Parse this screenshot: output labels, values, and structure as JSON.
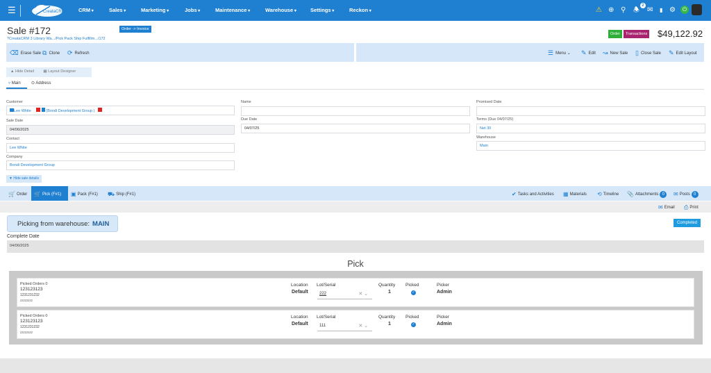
{
  "nav": {
    "logo_text": "CreataCRM",
    "menus": [
      "CRM",
      "Sales",
      "Marketing",
      "Jobs",
      "Maintenance",
      "Warehouse",
      "Settings",
      "Reckon"
    ],
    "notification_count": "2",
    "colors": {
      "nav_bg": "#1f7fd1",
      "warning": "#ffd21f",
      "online": "#39b54a"
    }
  },
  "header": {
    "title": "Sale #172",
    "breadcrumb": "?CreataCRM 3 Library Wa.../Pick Pack Ship Fulfillm.../172",
    "order_invoice_btn": "Order -> Invoice",
    "status_badge": "Order",
    "transactions_badge": "Transactions",
    "total": "$49,122.92"
  },
  "toolbar": {
    "erase": "Erase Sale",
    "clone": "Clone",
    "refresh": "Refresh",
    "menu": "Menu",
    "edit": "Edit",
    "new_sale": "New Sale",
    "close_sale": "Close Sale",
    "edit_layout": "Edit Layout"
  },
  "subtoolbar": {
    "hide_detail": "Hide Detail",
    "layout_designer": "Layout Designer"
  },
  "tabs": {
    "main": "Main",
    "address": "Address"
  },
  "form": {
    "customer_label": "Customer",
    "customer_value": "Lee White",
    "customer_company": "(Bondi Development Group )",
    "sale_date_label": "Sale Date",
    "sale_date_value": "04/06/2025",
    "contact_label": "Contact",
    "contact_value": "Lee White",
    "company_label": "Company",
    "company_value": "Bondi Development Group",
    "name_label": "Name",
    "name_value": "",
    "due_date_label": "Due Date",
    "due_date_value": "04/07/25",
    "promised_label": "Promised Date",
    "promised_value": "",
    "terms_label": "Terms (Due 04/07/25)",
    "terms_value": "Net 30",
    "warehouse_label": "Warehouse",
    "warehouse_value": "Main",
    "hide_sale_details": "Hide sale details"
  },
  "order_tabs": {
    "order": "Order",
    "pick": "Pick (F#1)",
    "pack": "Pack (F#1)",
    "ship": "Ship (F#1)",
    "tasks": "Tasks and Activities",
    "materials": "Materials",
    "timeline": "Timeline",
    "attachments": "Attachments",
    "attachments_count": "0",
    "posts": "Posts",
    "posts_count": "0"
  },
  "actions": {
    "email": "Email",
    "print": "Print"
  },
  "picking": {
    "prefix": "Picking from warehouse:",
    "warehouse": "MAIN",
    "completed": "Completed",
    "complete_date_label": "Complete Date",
    "complete_date_value": "04/06/2025",
    "heading": "Pick"
  },
  "pick_rows": [
    {
      "picked_label": "Picked Orders 0",
      "code": "123123123",
      "code2": "1231231232",
      "code3": "zzzzzzzz",
      "location_label": "Location",
      "location": "Default",
      "lot_label": "Lot/Serial",
      "lot": "222",
      "qty_label": "Quantity",
      "qty": "1",
      "picked_col": "Picked",
      "picker_label": "Picker",
      "picker": "Admin"
    },
    {
      "picked_label": "Picked Orders 0",
      "code": "123123123",
      "code2": "1231231232",
      "code3": "zzzzzzzz",
      "location_label": "Location",
      "location": "Default",
      "lot_label": "Lot/Serial",
      "lot": "111",
      "qty_label": "Quantity",
      "qty": "1",
      "picked_col": "Picked",
      "picker_label": "Picker",
      "picker": "Admin"
    }
  ]
}
